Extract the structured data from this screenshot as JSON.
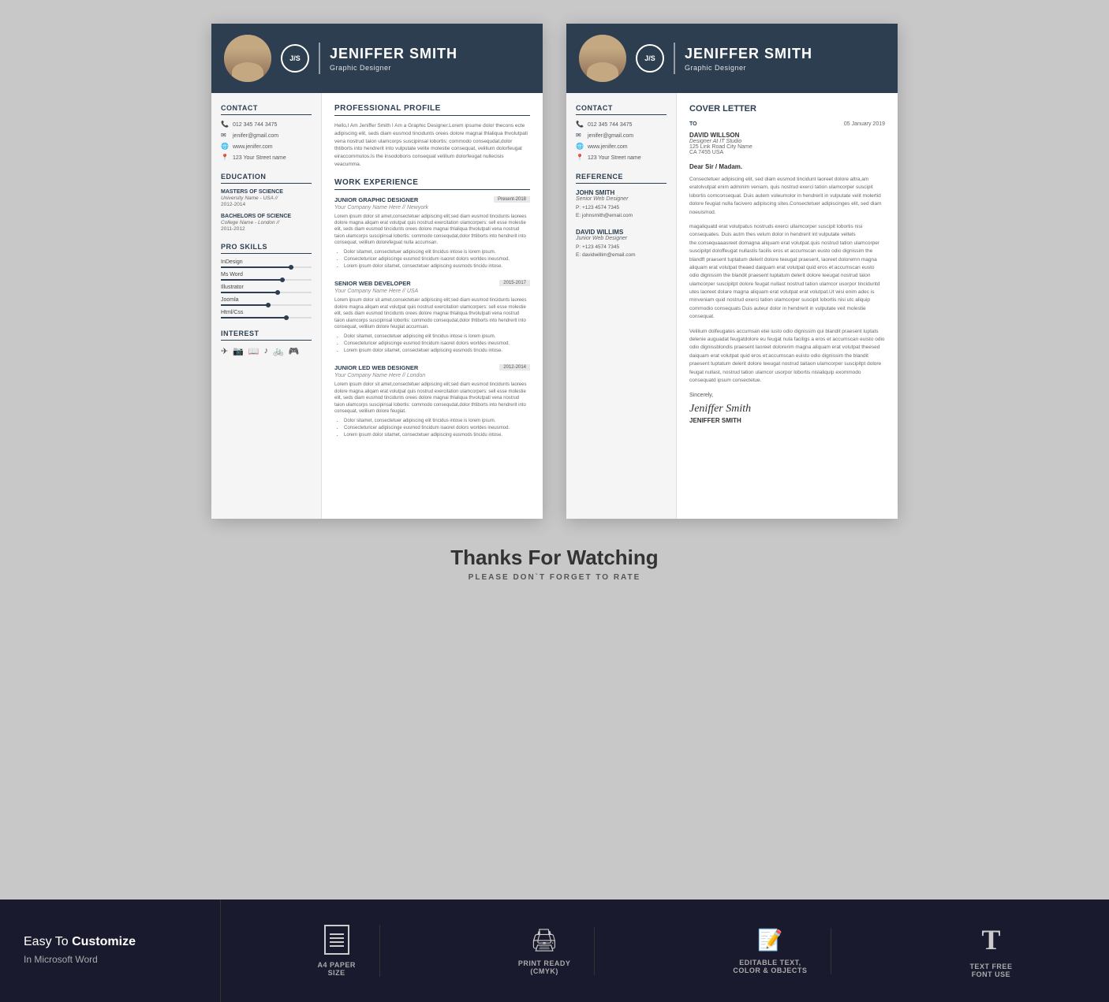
{
  "resume": {
    "header": {
      "monogram": "J/S",
      "name": "JENIFFER SMITH",
      "title": "Graphic Designer"
    },
    "sidebar": {
      "contact_title": "Contact",
      "phone": "012 345 744 3475",
      "email": "jenifer@gmail.com",
      "website": "www.jenifer.com",
      "address": "123 Your Street name",
      "education_title": "Education",
      "edu": [
        {
          "degree": "MASTERS OF SCIENCE",
          "school": "University Name - USA //",
          "years": "2012-2014"
        },
        {
          "degree": "BACHELORS OF SCIENCE",
          "school": "College Name - London //",
          "years": "2011-2012"
        }
      ],
      "skills_title": "Pro Skills",
      "skills": [
        {
          "name": "InDesign",
          "level": 80
        },
        {
          "name": "Ms Word",
          "level": 70
        },
        {
          "name": "Illustrator",
          "level": 65
        },
        {
          "name": "Joomla",
          "level": 55
        },
        {
          "name": "Html/Css",
          "level": 75
        }
      ],
      "interest_title": "Interest",
      "interest_icons": [
        "✈",
        "📷",
        "📖",
        "♪",
        "🚲",
        "🎮"
      ]
    },
    "main": {
      "profile_title": "Professional Profile",
      "profile_text": "Hello,I Am Jeniffer Smith I Am a Graphic Designer.Lorem ipsume dolor thecons ecte adipiscing elit, seds diam eusmod tincidunts orees dolore magnai thlaliqua thvolutpati vena nostrud taion ulamcorps suscipinsal lobortis: commodo consequdat,dolor thtiborts into hendrerit into vulputate velite molestie consequat, velilium dolorfeugat eiraccommutos.Is the insodoboris consequat velilium dolorfeugat nullecisis veacumma.",
      "work_title": "Work Experience",
      "jobs": [
        {
          "title": "JUNIOR GRAPHIC DESIGNER",
          "years": "Present-2018",
          "company": "Your Company Name Here // Newyork",
          "desc": "Lorem ipsum dolor sit amet,consectetuer adipiscing elit;sed diam eusmod tincidunts laorees dolore magna aliqam erat volutpat quis nostrud exercitation ulamcorpers: sell esse molestie elit, seds diam eusmod tincidunts orees dolore magnai thlaliqua thvolutpati vena nostrud taion ulamcorps suscipinsal lobortis: commodo consequdat,dolor thtiborts into hendrerit into  consequat, velilium dolorefeguat nulla accumsan.",
          "bullets": [
            "Dolor sitamet, consectetuer adipiscing elit tincidus intose is lorem ipsum.",
            "Consecteturicer adipiscinge eusmod tincidum  isaoret dolors worldes ineusmod.",
            "Lorem ipsum dolor sitamet, consectetuer adipiscing eusmods tincidu intose."
          ]
        },
        {
          "title": "SENIOR WEB DEVELOPER",
          "years": "2015-2017",
          "company": "Your Company Name Here // USA",
          "desc": "Lorem ipsum dolor sit amet,consectetuer adipiscing elit;sed diam eusmod tincidunts laorees dolore magna aliqam erat volutpat quis nostrud exercitation ulamcorpers: sell esse molestie elit, seds diam eusmod tincidunts orees dolore magnai thlaliqua thvolutpati vena nostrud taion ulamcorps suscipinsal lobortis: commodo consequdat,dolor thtiborts into hendrerit into consequat, velilium dolore feugiat accumsan.",
          "bullets": [
            "Dolor sitamet, consectetuer adipiscing elit tincidus intose is lorem ipsum.",
            "Consecteturicer adipiscinge eusmod tincidum  isaoret dolors worldes ineusmod.",
            "Lorem ipsum dolor sitamet, consectetuer adipiscing eusmods tincidu intose."
          ]
        },
        {
          "title": "JUNIOR LED WEB DESIGNER",
          "years": "2012-2014",
          "company": "Your Company Name Here // London",
          "desc": "Lorem ipsum dolor sit amet,consectetuer adipiscing elit;sed diam eusmod tincidunts laorees dolore magna aliqam erat volutpat quis nostrud exercitation ulamcorpers: sell esse molestie elit, seds diam eusmod tincidunts orees dolore magnai thlaliqua thvolutpati vena nostrud taion ulamcorps suscipinsal lobortis: commodo consequdat,dolor thtiborts into hendrerit into  consequat, velilium dolore feugiat.",
          "bullets": [
            "Dolor sitamet, consectetuer adipiscing elit tincidus intose is lorem ipsum.",
            "Consecteturicer adipiscinge eusmod tincidum  isaoret dolors worldes ineusmod.",
            "Lorem ipsum dolor sitamet, consectetuer adipiscing eusmods tincidu intose."
          ]
        }
      ]
    }
  },
  "cover": {
    "header": {
      "monogram": "J/S",
      "name": "JENIFFER SMITH",
      "title": "Graphic Designer"
    },
    "sidebar": {
      "contact_title": "Contact",
      "phone": "012 345 744 3475",
      "email": "jenifer@gmail.com",
      "website": "www.jenifer.com",
      "address": "123 Your Street name",
      "reference_title": "Reference",
      "references": [
        {
          "name": "JOHN SMITH",
          "position": "Senior Web Designer",
          "phone": "P: +123 4574 7345",
          "email": "E: johnsmith@email.com"
        },
        {
          "name": "DAVID WILLIMS",
          "position": "Junior Web Designer",
          "phone": "P: +123 4574 7345",
          "email": "E: davidwillim@email.com"
        }
      ]
    },
    "main": {
      "letter_title": "Cover Letter",
      "to_label": "TO",
      "date": "05 January 2019",
      "addressee_name": "DAVID WILLSON",
      "addressee_title": "Designer At IT Studio",
      "address_line1": "125 Link Road City Name",
      "address_line2": "CA 7455 USA",
      "greeting": "Dear Sir / Madam.",
      "paragraphs": [
        "Consectetuer adipiscing elit, sed diam eusmod tincidunt laoreet dolore altra,am eratolvutpat enim adminim veniam, quis nostrud exerci tation ulamcorper suscipit lobortis comconsequat. Duis autem voleumolor in hendrerit in vulputate velit molertid dolore feugiat nulla facivero adipiscing sites.Consectetuer adipiscinges elit, sed diam noeuismod.",
        "magaliquatd erat volutpatus nostruds exerci ullamcorper suscipit lobortis nisi consequates. Duis autm thes velum dolor in hendrerit int vulputate veltels the:consequaaasreet domagna aliquam erat volutpat.quis nostrud tation ulamcorper suscipitpt  doloffeugat nullastis facilis eros et accumscan eusto odio dignissim the blandft praesent tuptatum delerit dolore teeugat praesent, laoreet doloremn magna aliquam erat volutpat theaed daiquam erat volutpat quid eros et:accumscan eusto odio dignissim the blandit praesent tuptatum delerit dolore teeugat nostrud taion ulamcorper suscipitpt  dolore feugat nullast nostrud tation ulamcor usorpor tinciduntd utes laoreet dolare magna aliquam erat volutpat erat volutpat.Ut wisi enim adec is minveniam quid nostrud exerci tation ulamcorper suscipit lobortis nisi utc aliquip commodio consequats Duis auteur dolor in hendrerit in vulputate veit molestie consequat.",
        "Velilium dolfeugates accumsan etei iusto odio dignissim qui blandit praesent luptats delenie auguadat feugatdolore eu feugat nula faciligs a eros et accumscan euisto odio odio dignissblondis praesent  laoreet dolorerim magna aliquam erat volutpat theesed daiquam erat volutpat quid eros et:accumscan euisto odio dignissim the blandit praesent tuptatum delerit dolore teeugat nostrud taitaon ulamcorper suscipitpt  dolore feugat nullast, nostrud tation ulamcor usorpor lobortis nislaliquip exommodo consequatd ipsum consectetue."
      ],
      "sincerely": "Sincerely,",
      "signature": "Jeniffer Smith",
      "sig_name": "JENIFFER SMITH"
    }
  },
  "watching": {
    "title": "Thanks For Watching",
    "subtitle": "PLEASE DON`T FORGET TO RATE"
  },
  "bottom_bar": {
    "easy_text": "Easy To",
    "customize_text": "Customize",
    "in_ms": "In Microsoft Word",
    "features": [
      {
        "icon": "doc",
        "label": "A4 PAPER\nSIZE"
      },
      {
        "icon": "print",
        "label": "PRINT READY\n(CMYK)"
      },
      {
        "icon": "edit",
        "label": "EDITABLE TEXT,\nCOLOR & OBJECTS"
      },
      {
        "icon": "T",
        "label": "TEXT FREE\nFONT USE"
      }
    ]
  }
}
